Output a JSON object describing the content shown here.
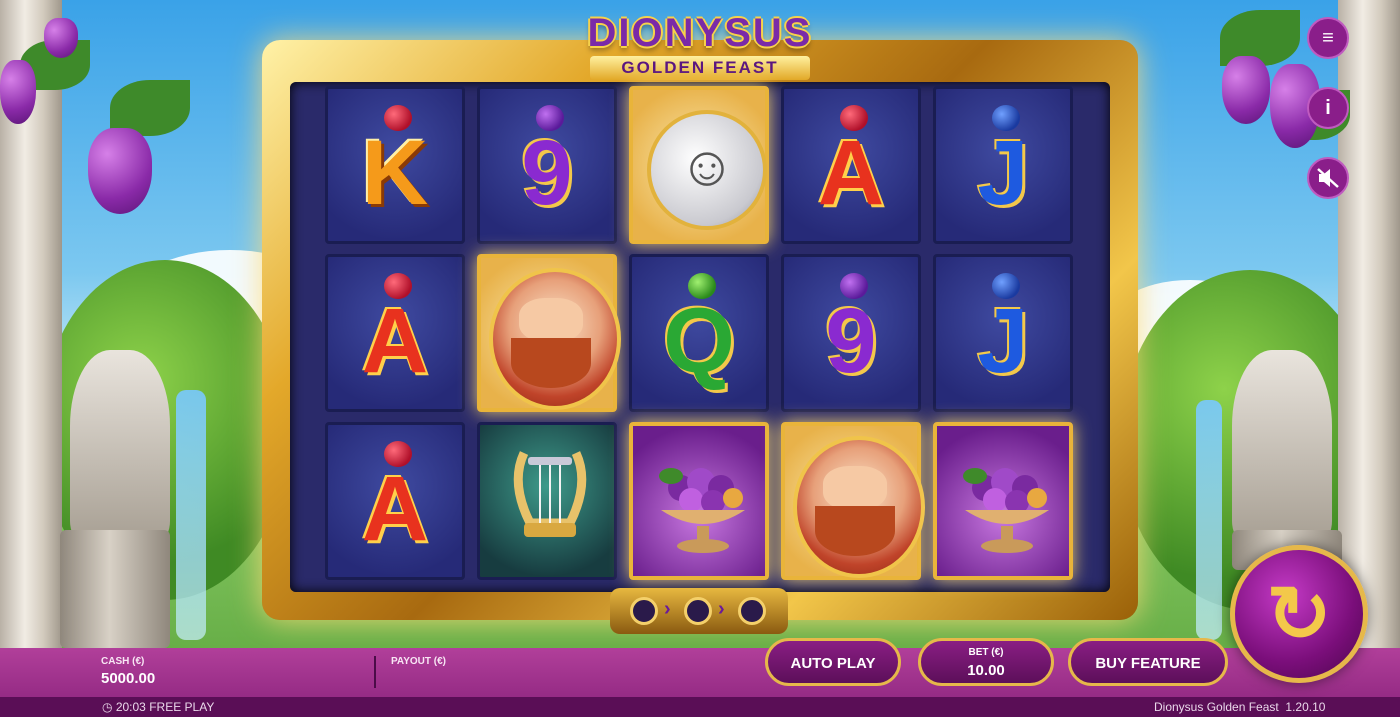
{
  "game": {
    "title_main": "DIONYSUS",
    "title_sub": "GOLDEN FEAST"
  },
  "reels": [
    [
      "K",
      "9",
      "masks",
      "A",
      "J"
    ],
    [
      "A",
      "dionysus",
      "Q",
      "9",
      "J"
    ],
    [
      "A",
      "lyre",
      "fruit-bowl",
      "dionysus",
      "fruit-bowl"
    ]
  ],
  "icons": {
    "menu": "menu-icon",
    "info": "info-icon",
    "sound": "sound-muted-icon",
    "spin": "spin-icon",
    "clock": "clock-icon"
  },
  "controls": {
    "cash_label": "CASH (€)",
    "cash_value": "5000.00",
    "payout_label": "PAYOUT (€)",
    "auto_play": "AUTO PLAY",
    "bet_label": "BET (€)",
    "bet_value": "10.00",
    "buy_feature": "BUY FEATURE"
  },
  "status": {
    "time": "20:03",
    "mode": "FREE PLAY",
    "game_name": "Dionysus Golden Feast",
    "version": "1.20.10"
  },
  "colors": {
    "accent_purple": "#8a1e84",
    "gold": "#e6b84a",
    "bar": "#a5348f"
  }
}
